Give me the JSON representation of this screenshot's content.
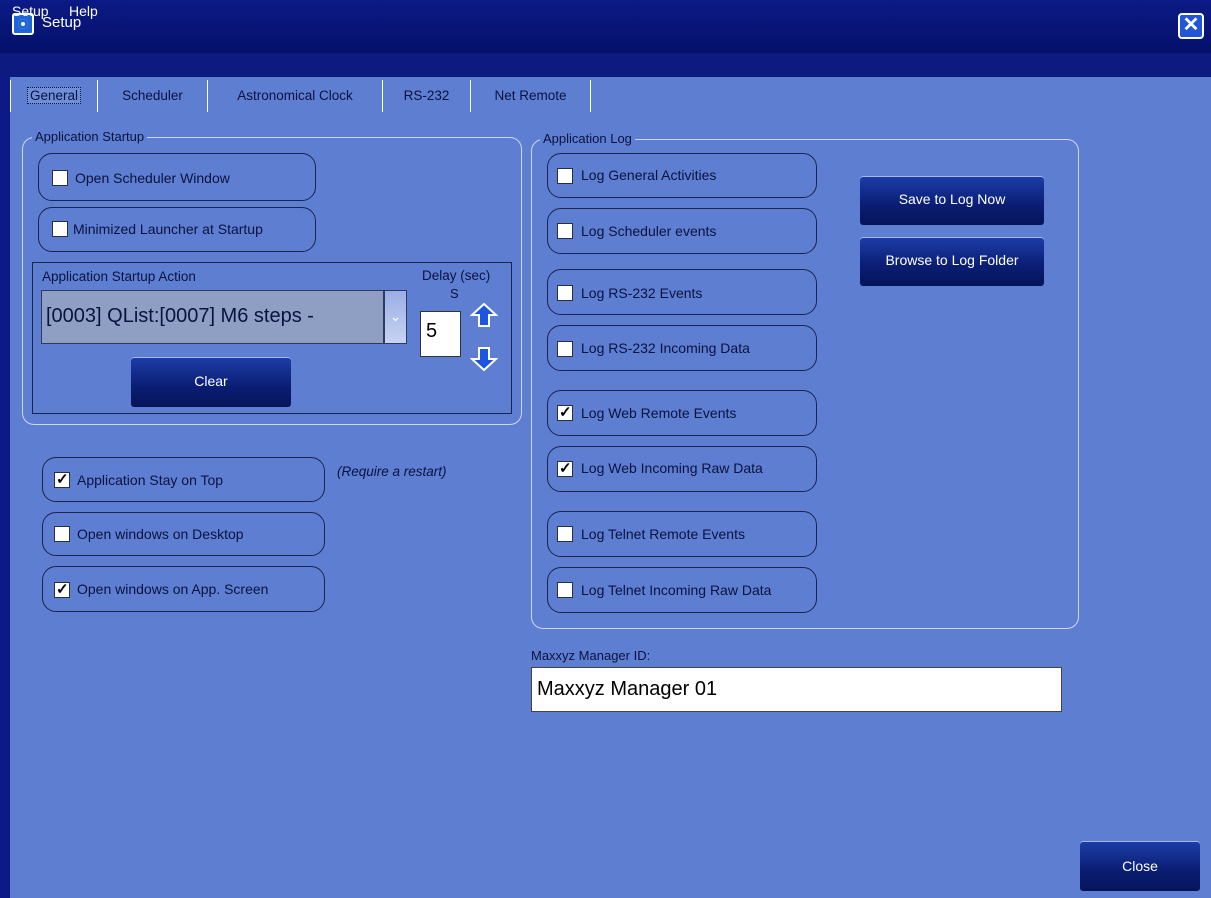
{
  "window": {
    "title": "Setup"
  },
  "menu": [
    "Setup",
    "Help"
  ],
  "tabs": [
    "General",
    "Scheduler",
    "Astronomical Clock",
    "RS-232",
    "Net Remote"
  ],
  "startup": {
    "legend": "Application Startup",
    "open_scheduler": {
      "label": "Open Scheduler Window",
      "checked": false
    },
    "minimized_launcher": {
      "label": "Minimized Launcher at Startup",
      "checked": false
    },
    "action_label": "Application Startup Action",
    "action_value": "[0003] QList:[0007] M6 steps -",
    "delay_label": "Delay (sec)",
    "delay_unit": "S",
    "delay_value": "5",
    "clear_button": "Clear"
  },
  "options": {
    "stay_on_top": {
      "label": "Application Stay on Top",
      "checked": true
    },
    "restart_note": "(Require a restart)",
    "open_desktop": {
      "label": "Open windows on Desktop",
      "checked": false
    },
    "open_app_screen": {
      "label": "Open windows on App. Screen",
      "checked": true
    }
  },
  "log": {
    "legend": "Application Log",
    "items": [
      {
        "label": "Log General Activities",
        "checked": false
      },
      {
        "label": "Log Scheduler events",
        "checked": false
      },
      {
        "label": "Log RS-232 Events",
        "checked": false
      },
      {
        "label": "Log RS-232 Incoming Data",
        "checked": false
      },
      {
        "label": "Log Web Remote Events",
        "checked": true
      },
      {
        "label": "Log Web Incoming Raw Data",
        "checked": true
      },
      {
        "label": "Log Telnet Remote Events",
        "checked": false
      },
      {
        "label": "Log Telnet Incoming Raw Data",
        "checked": false
      }
    ],
    "save_button": "Save to Log Now",
    "browse_button": "Browse to Log Folder"
  },
  "manager": {
    "label": "Maxxyz Manager ID:",
    "value": "Maxxyz Manager 01"
  },
  "close_button": "Close"
}
